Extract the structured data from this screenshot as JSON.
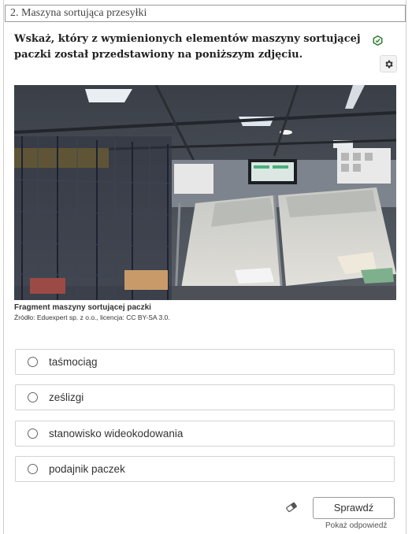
{
  "exercise": {
    "title": "2. Maszyna sortująca przesyłki",
    "question": "Wskaż, który z wymienionych elementów maszyny sortującej paczki został przedstawiony na poniższym zdjęciu."
  },
  "figure": {
    "caption_title": "Fragment maszyny sortującej paczki",
    "caption_source": "Źródło: Eduexpert sp. z o.o., licencja: CC BY-SA 3.0."
  },
  "options": [
    {
      "label": "taśmociąg"
    },
    {
      "label": "ześlizgi"
    },
    {
      "label": "stanowisko wideokodowania"
    },
    {
      "label": "podajnik paczek"
    }
  ],
  "actions": {
    "check_label": "Sprawdź",
    "show_answer_label": "Pokaż odpowiedź"
  },
  "icons": {
    "hex": "hexagon-check-icon",
    "settings": "gear-icon",
    "eraser": "eraser-icon"
  },
  "colors": {
    "accent_green": "#2e7d32"
  }
}
